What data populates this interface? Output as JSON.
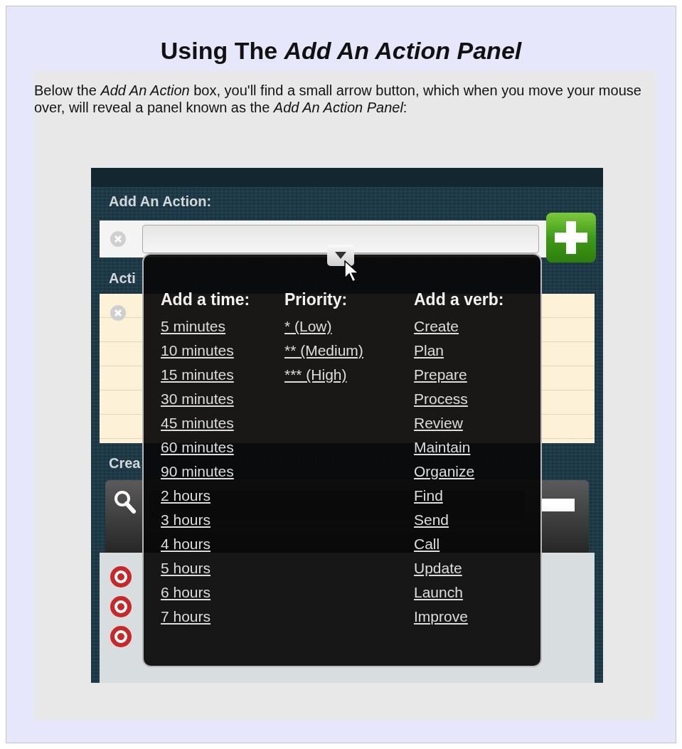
{
  "article": {
    "heading": "Using The *Add An Action Panel*",
    "intro": "Below the *Add An Action* box, you'll find a small arrow button, which when you move your mouse over, will reveal a panel known as the *Add An Action Panel*:"
  },
  "screenshot": {
    "add_action_label": "Add An Action:",
    "notes_label": "Acti",
    "timer_label": "Crea",
    "panel": {
      "columns": [
        {
          "heading": "Add a time:",
          "items": [
            "5 minutes",
            "10 minutes",
            "15 minutes",
            "30 minutes",
            "45 minutes",
            "60 minutes",
            "90 minutes",
            "2 hours",
            "3 hours",
            "4 hours",
            "5 hours",
            "6 hours",
            "7 hours"
          ]
        },
        {
          "heading": "Priority:",
          "items": [
            "* (Low)",
            "** (Medium)",
            "*** (High)"
          ]
        },
        {
          "heading": "Add a verb:",
          "items": [
            "Create",
            "Plan",
            "Prepare",
            "Process",
            "Review",
            "Maintain",
            "Organize",
            "Find",
            "Send",
            "Call",
            "Update",
            "Launch",
            "Improve"
          ]
        }
      ]
    }
  }
}
